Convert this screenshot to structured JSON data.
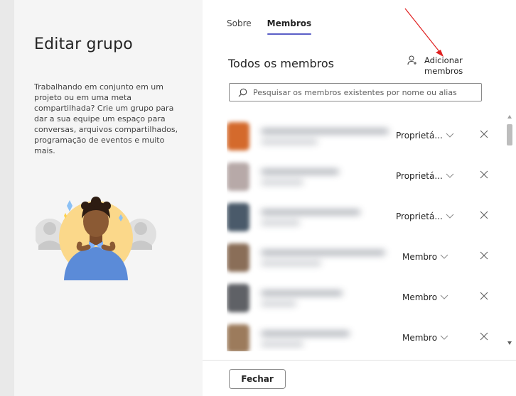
{
  "left": {
    "title": "Editar grupo",
    "description": "Trabalhando em conjunto em um projeto ou em uma meta compartilhada? Crie um grupo para dar a sua equipe um espaço para conversas, arquivos compartilhados, programação de eventos e muito mais."
  },
  "tabs": [
    {
      "label": "Sobre",
      "active": false
    },
    {
      "label": "Membros",
      "active": true
    }
  ],
  "members_section": {
    "title": "Todos os membros",
    "add_label": "Adicionar membros",
    "add_icon": "person-add-icon",
    "search_placeholder": "Pesquisar os membros existentes por nome ou alias"
  },
  "members": [
    {
      "role": "Proprietá...",
      "avatar_color": "#d46a2c"
    },
    {
      "role": "Proprietá...",
      "avatar_color": "#b7a9a8"
    },
    {
      "role": "Proprietá...",
      "avatar_color": "#4a5a6a"
    },
    {
      "role": "Membro",
      "avatar_color": "#8a6e58"
    },
    {
      "role": "Membro",
      "avatar_color": "#5f6166"
    },
    {
      "role": "Membro",
      "avatar_color": "#9c7b5c"
    }
  ],
  "footer": {
    "close_label": "Fechar"
  },
  "colors": {
    "accent": "#5b5fc7",
    "annotation_arrow": "#e02020"
  }
}
